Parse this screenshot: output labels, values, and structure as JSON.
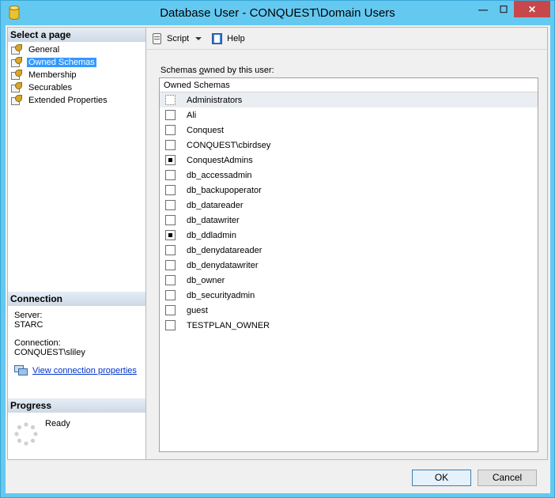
{
  "window": {
    "title": "Database User - CONQUEST\\Domain Users",
    "minimize": "—",
    "maximize": "☐",
    "close": "✕"
  },
  "left": {
    "select_header": "Select a page",
    "pages": [
      {
        "label": "General"
      },
      {
        "label": "Owned Schemas"
      },
      {
        "label": "Membership"
      },
      {
        "label": "Securables"
      },
      {
        "label": "Extended Properties"
      }
    ],
    "selected_page": "Owned Schemas",
    "connection_header": "Connection",
    "server_label": "Server:",
    "server_value": "STARC",
    "connection_label": "Connection:",
    "connection_value": "CONQUEST\\sliley",
    "view_link": "View connection properties",
    "progress_header": "Progress",
    "progress_status": "Ready"
  },
  "toolbar": {
    "script_label": "Script",
    "help_label": "Help"
  },
  "main": {
    "schemas_label_prefix": "Schemas ",
    "schemas_label_underlined": "o",
    "schemas_label_suffix": "wned by this user:",
    "column_header": "Owned Schemas",
    "rows": [
      {
        "name": "Administrators",
        "checked": false
      },
      {
        "name": "Ali",
        "checked": false
      },
      {
        "name": "Conquest",
        "checked": false
      },
      {
        "name": "CONQUEST\\cbirdsey",
        "checked": false
      },
      {
        "name": "ConquestAdmins",
        "checked": true
      },
      {
        "name": "db_accessadmin",
        "checked": false
      },
      {
        "name": "db_backupoperator",
        "checked": false
      },
      {
        "name": "db_datareader",
        "checked": false
      },
      {
        "name": "db_datawriter",
        "checked": false
      },
      {
        "name": "db_ddladmin",
        "checked": true
      },
      {
        "name": "db_denydatareader",
        "checked": false
      },
      {
        "name": "db_denydatawriter",
        "checked": false
      },
      {
        "name": "db_owner",
        "checked": false
      },
      {
        "name": "db_securityadmin",
        "checked": false
      },
      {
        "name": "guest",
        "checked": false
      },
      {
        "name": "TESTPLAN_OWNER",
        "checked": false
      }
    ]
  },
  "footer": {
    "ok_label": "OK",
    "cancel_label": "Cancel"
  }
}
